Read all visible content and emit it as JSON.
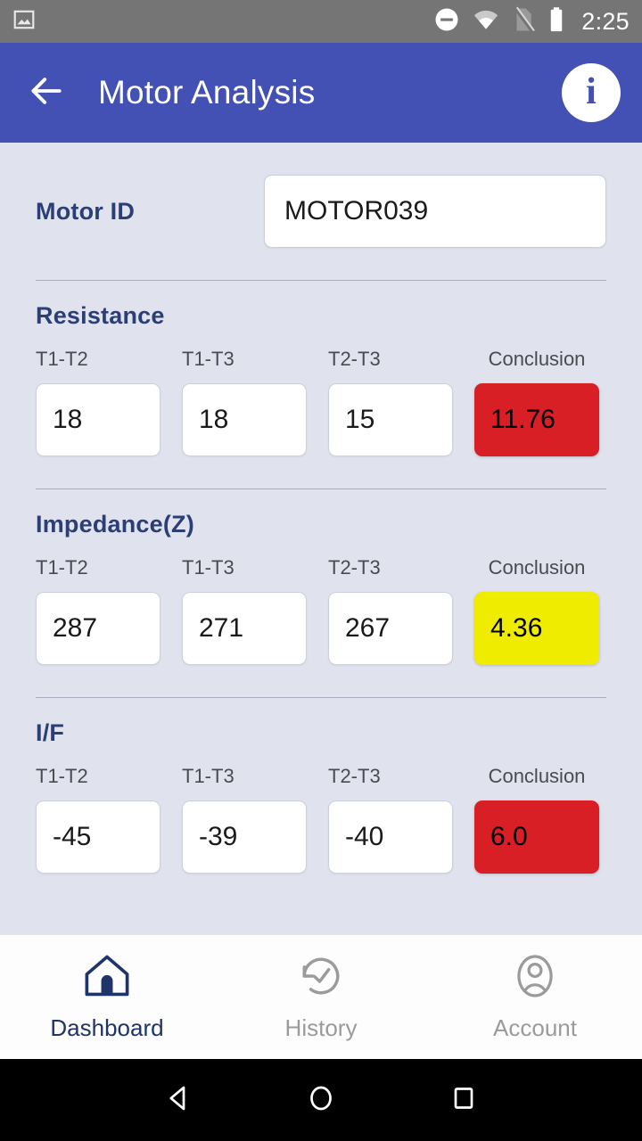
{
  "status_bar": {
    "time": "2:25",
    "icons": [
      "image-notification-icon",
      "do-not-disturb-icon",
      "wifi-icon",
      "no-sim-icon",
      "battery-icon"
    ],
    "background_color": "#757575"
  },
  "app_bar": {
    "title": "Motor Analysis",
    "back_icon": "arrow-left-icon",
    "info_icon": "info-icon",
    "info_glyph": "i",
    "background_color": "#4350b4"
  },
  "motor_id": {
    "label": "Motor ID",
    "value": "MOTOR039",
    "placeholder": "Motor ID"
  },
  "column_headers": [
    "T1-T2",
    "T1-T3",
    "T2-T3",
    "Conclusion"
  ],
  "sections": [
    {
      "title": "Resistance",
      "values": [
        "18",
        "18",
        "15"
      ],
      "conclusion": "11.76",
      "conclusion_status": "red",
      "conclusion_color": "#d81f26"
    },
    {
      "title": "Impedance(Z)",
      "values": [
        "287",
        "271",
        "267"
      ],
      "conclusion": "4.36",
      "conclusion_status": "yellow",
      "conclusion_color": "#f0ec00"
    },
    {
      "title": "I/F",
      "values": [
        "-45",
        "-39",
        "-40"
      ],
      "conclusion": "6.0",
      "conclusion_status": "red",
      "conclusion_color": "#d81f26"
    }
  ],
  "bottom_nav": {
    "items": [
      {
        "label": "Dashboard",
        "icon": "home-icon",
        "active": true
      },
      {
        "label": "History",
        "icon": "history-clock-icon",
        "active": false
      },
      {
        "label": "Account",
        "icon": "person-icon",
        "active": false
      }
    ],
    "active_color": "#1f3468",
    "inactive_color": "#9b9b9b"
  },
  "android_nav": {
    "back_icon": "triangle-back-icon",
    "home_icon": "circle-home-icon",
    "recents_icon": "square-recents-icon"
  },
  "theme": {
    "background": "#e0e2ee",
    "heading_color": "#2c3f75",
    "primary": "#4350b4"
  }
}
